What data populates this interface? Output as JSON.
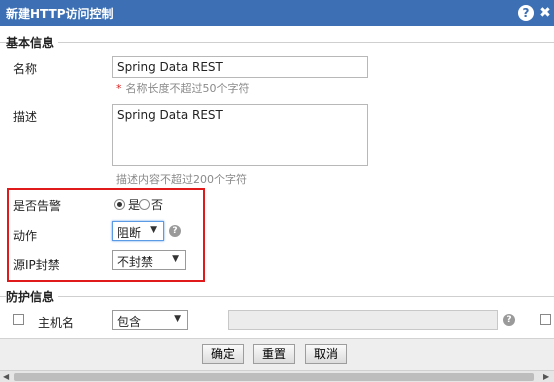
{
  "dialog": {
    "title": "新建HTTP访问控制",
    "help_icon": "?",
    "close_icon": "✖"
  },
  "basic_section": {
    "title": "基本信息",
    "name_label": "名称",
    "name_value": "Spring Data REST",
    "name_hint": "名称长度不超过50个字符",
    "required_mark": "*",
    "desc_label": "描述",
    "desc_value": "Spring Data REST",
    "desc_hint": "描述内容不超过200个字符",
    "alarm_label": "是否告警",
    "alarm_options": [
      "是",
      "否"
    ],
    "alarm_selected": "是",
    "action_label": "动作",
    "action_value": "阻断",
    "source_ip_label": "源IP封禁",
    "source_ip_value": "不封禁"
  },
  "protect_section": {
    "title": "防护信息",
    "host_label": "主机名",
    "match_value": "包含",
    "host_value": ""
  },
  "footer": {
    "ok_label": "确定",
    "reset_label": "重置",
    "cancel_label": "取消"
  },
  "colors": {
    "titlebar": "#3c6fb4",
    "highlight_box": "#e01a1a",
    "required": "#dd2222"
  },
  "icons": {
    "help": "question-circle-icon",
    "close": "close-icon",
    "dropdown": "caret-down-icon"
  }
}
